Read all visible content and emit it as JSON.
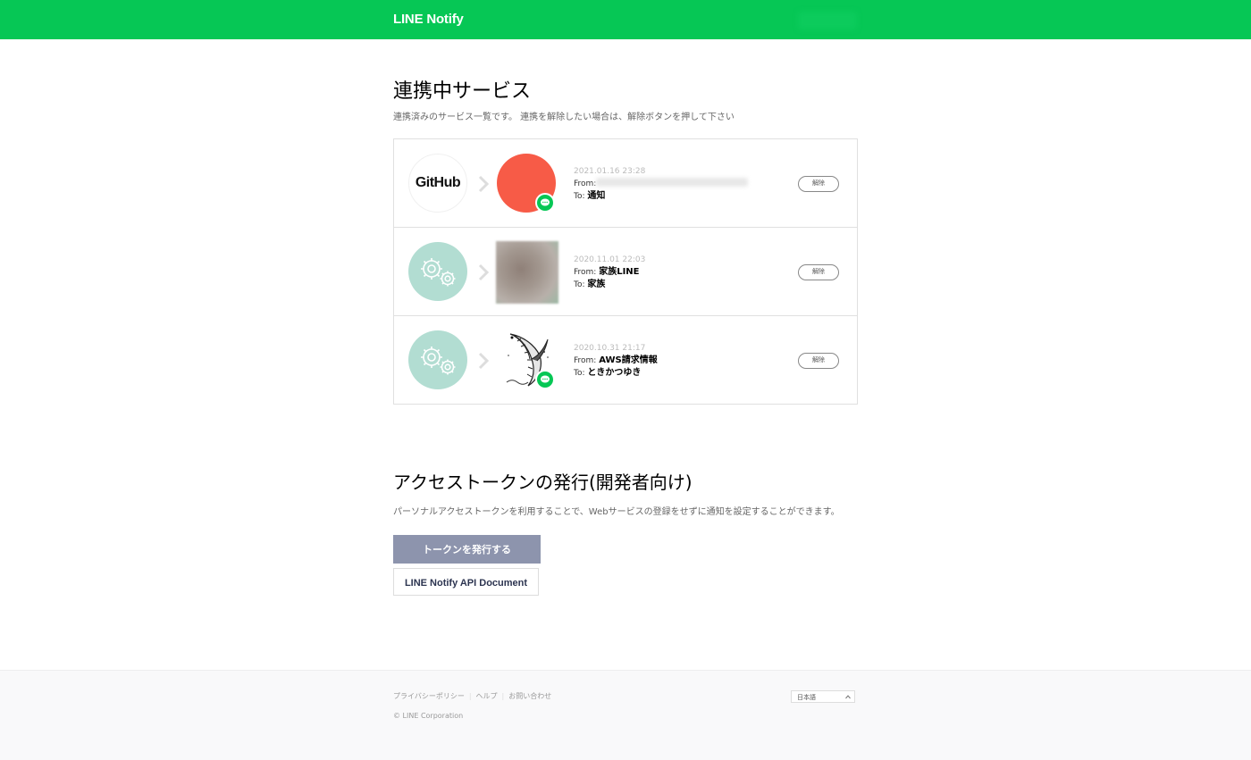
{
  "header": {
    "logo": "LINE Notify"
  },
  "connected": {
    "title": "連携中サービス",
    "description": "連携済みのサービス一覧です。 連携を解除したい場合は、解除ボタンを押して下さい",
    "unlink_label": "解除",
    "services": [
      {
        "source_label": "GitHub",
        "source_icon": "github-logo",
        "date": "2021.01.16 23:28",
        "from_label": "From:",
        "from": "",
        "to_label": "To:",
        "to": "通知"
      },
      {
        "source_icon": "gears-icon",
        "date": "2020.11.01 22:03",
        "from_label": "From:",
        "from": "家族LINE",
        "to_label": "To:",
        "to": "家族"
      },
      {
        "source_icon": "gears-icon",
        "date": "2020.10.31 21:17",
        "from_label": "From:",
        "from": "AWS請求情報",
        "to_label": "To:",
        "to": "ときかつゆき"
      }
    ]
  },
  "token": {
    "title": "アクセストークンの発行(開発者向け)",
    "description": "パーソナルアクセストークンを利用することで、Webサービスの登録をせずに通知を設定することができます。",
    "issue_button": "トークンを発行する",
    "doc_button": "LINE Notify API Document"
  },
  "footer": {
    "links": [
      "プライバシーポリシー",
      "ヘルプ",
      "お問い合わせ"
    ],
    "copyright": "© LINE Corporation",
    "language": "日本語"
  },
  "colors": {
    "brand": "#06c755",
    "primary_button": "#8d94ad",
    "gear_bg": "#b2ddd2"
  }
}
